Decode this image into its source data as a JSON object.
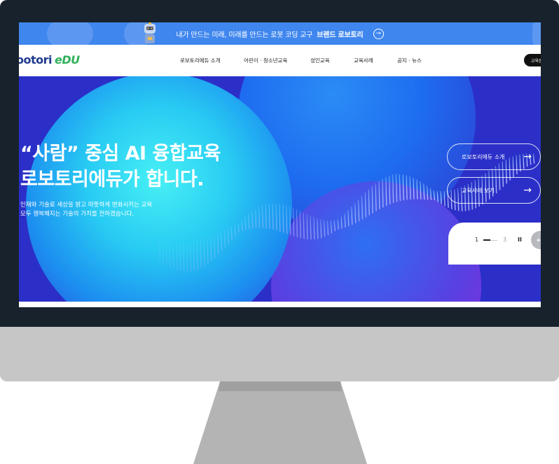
{
  "banner": {
    "text": "내가 만드는 미래, 미래를 만드는 로봇 코딩 교구",
    "highlight": "브랜드 로보토리",
    "arrow_icon": "circle-arrow-right-icon"
  },
  "logo": {
    "main": "ootori",
    "suffix": "eDU"
  },
  "nav": {
    "items": [
      "로보토리에듀 소개",
      "어린이 · 청소년교육",
      "성인교육",
      "교육사례",
      "공지 · 뉴스"
    ],
    "cta": "교육문"
  },
  "hero": {
    "title_line1": "“사람” 중심 AI 융합교육",
    "title_line2": "로보토리에듀가 합니다.",
    "sub_line1": "인재와 기술로 세상을 밝고 따뜻하게 변화시키는 교육",
    "sub_line2": "모두 행복해지는 기술의 가치를 전하겠습니다.",
    "buttons": [
      "로보토리에듀 소개",
      "교육사례 보기"
    ],
    "pager": {
      "current": "1",
      "total": "3",
      "pause": "II"
    }
  },
  "colors": {
    "banner": "#3f86ee",
    "hero_bg": "#2b2fc8",
    "logo_blue": "#1f3b8f",
    "logo_green": "#2fb15a"
  }
}
